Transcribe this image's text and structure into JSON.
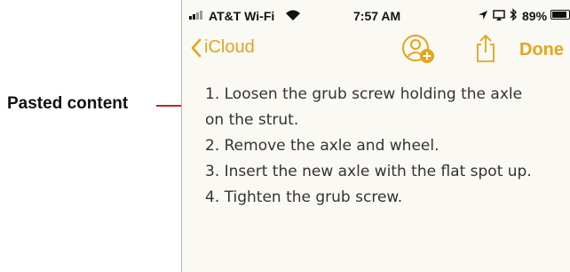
{
  "callout": {
    "label": "Pasted content",
    "line_color": "#c0272d"
  },
  "status_bar": {
    "carrier": "AT&T Wi-Fi",
    "time": "7:57 AM",
    "battery_percent": "89%",
    "battery_level": 0.89,
    "icons": [
      "signal-icon",
      "wifi-icon",
      "location-icon",
      "screen-mirroring-icon",
      "bluetooth-icon",
      "battery-icon"
    ]
  },
  "nav": {
    "back_label": "iCloud",
    "done_label": "Done",
    "accent_color": "#e3a51b",
    "icons": [
      "chevron-left-icon",
      "add-person-icon",
      "share-icon"
    ]
  },
  "note": {
    "lines": [
      "1. Loosen the grub screw holding the axle",
      "on the strut.",
      "2. Remove the axle and wheel.",
      "3. Insert the new axle with the flat spot up.",
      "4. Tighten the grub screw."
    ]
  }
}
